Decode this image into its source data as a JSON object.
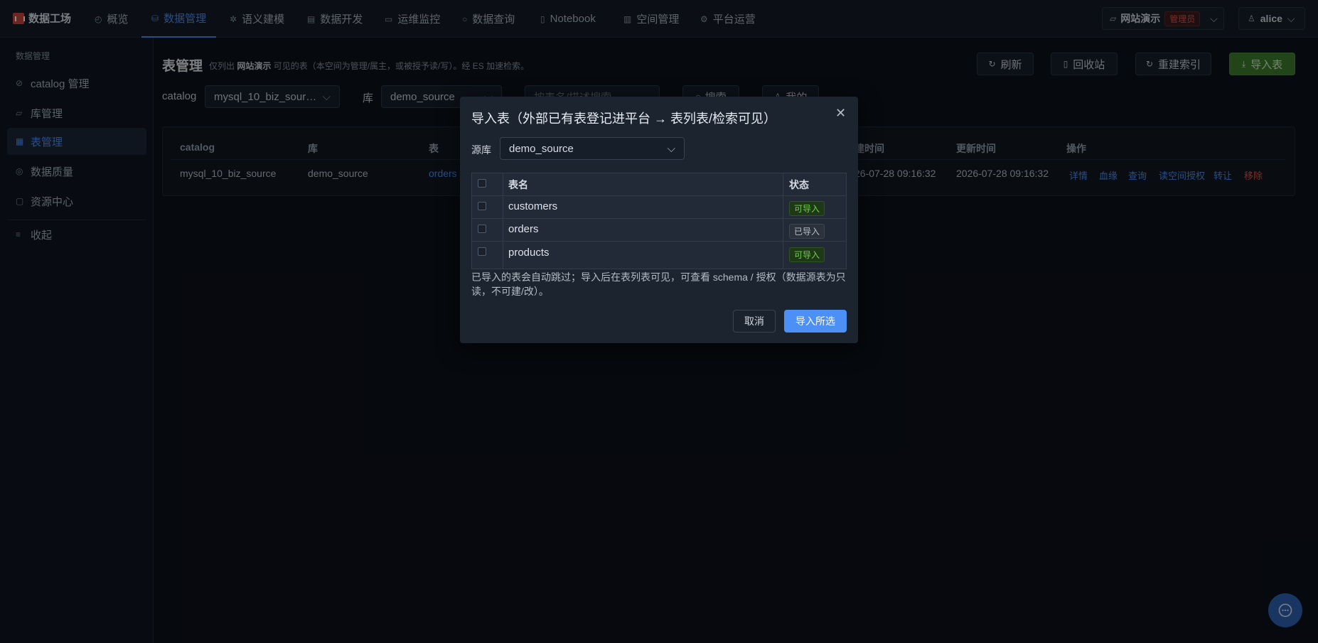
{
  "app": {
    "title": "数据工场"
  },
  "nav": {
    "items": [
      {
        "label": "概览",
        "icon": "dashboard-icon"
      },
      {
        "label": "数据管理",
        "icon": "database-icon"
      },
      {
        "label": "语义建模",
        "icon": "sparkle-icon"
      },
      {
        "label": "数据开发",
        "icon": "code-file-icon"
      },
      {
        "label": "运维监控",
        "icon": "monitor-icon"
      },
      {
        "label": "数据查询",
        "icon": "search-icon"
      },
      {
        "label": "Notebook",
        "icon": "notebook-icon"
      },
      {
        "label": "空间管理",
        "icon": "building-icon"
      },
      {
        "label": "平台运营",
        "icon": "settings-icon"
      }
    ],
    "active_index": 1
  },
  "workspace": {
    "name": "网站演示",
    "role_badge": "管理员"
  },
  "user": {
    "name": "alice"
  },
  "sidebar": {
    "group_label": "数据管理",
    "items": [
      {
        "label": "catalog 管理",
        "icon": "link-icon"
      },
      {
        "label": "库管理",
        "icon": "folder-icon"
      },
      {
        "label": "表管理",
        "icon": "table-icon"
      },
      {
        "label": "数据质量",
        "icon": "check-circle-icon"
      },
      {
        "label": "资源中心",
        "icon": "box-icon"
      }
    ],
    "active_index": 2,
    "collapse_label": "收起"
  },
  "page": {
    "title": "表管理",
    "desc_prefix": "仅列出",
    "desc_workspace": "网站演示",
    "desc_suffix": "可见的表（本空间为管理/属主，或被授予读/写）。经 ES 加速检索。",
    "buttons": {
      "refresh": "刷新",
      "recycle": "回收站",
      "reindex": "重建索引",
      "import": "导入表"
    }
  },
  "filters": {
    "catalog_label": "catalog",
    "catalog_value": "mysql_10_biz_sour…",
    "db_label": "库",
    "db_value": "demo_source",
    "search_placeholder": "按表名/描述搜索",
    "search_button": "搜索",
    "mine_button": "我的"
  },
  "table": {
    "headers": [
      "catalog",
      "库",
      "表",
      "建时间",
      "更新时间",
      "操作"
    ],
    "rows": [
      {
        "catalog": "mysql_10_biz_source",
        "db": "demo_source",
        "table": "orders",
        "created": "26-07-28 09:16:32",
        "updated": "2026-07-28 09:16:32",
        "actions": [
          "详情",
          "血缘",
          "查询",
          "读空间授权",
          "转让",
          "移除"
        ]
      }
    ]
  },
  "modal": {
    "title": "导入表（外部已有表登记进平台 → 表列表/检索可见）",
    "source_label": "源库",
    "source_value": "demo_source",
    "headers": {
      "name": "表名",
      "status": "状态"
    },
    "rows": [
      {
        "name": "customers",
        "status": "可导入",
        "importable": true
      },
      {
        "name": "orders",
        "status": "已导入",
        "importable": false
      },
      {
        "name": "products",
        "status": "可导入",
        "importable": true
      }
    ],
    "note": "已导入的表会自动跳过；导入后在表列表可见，可查看 schema / 授权（数据源表为只读，不可建/改）。",
    "cancel": "取消",
    "confirm": "导入所选"
  }
}
